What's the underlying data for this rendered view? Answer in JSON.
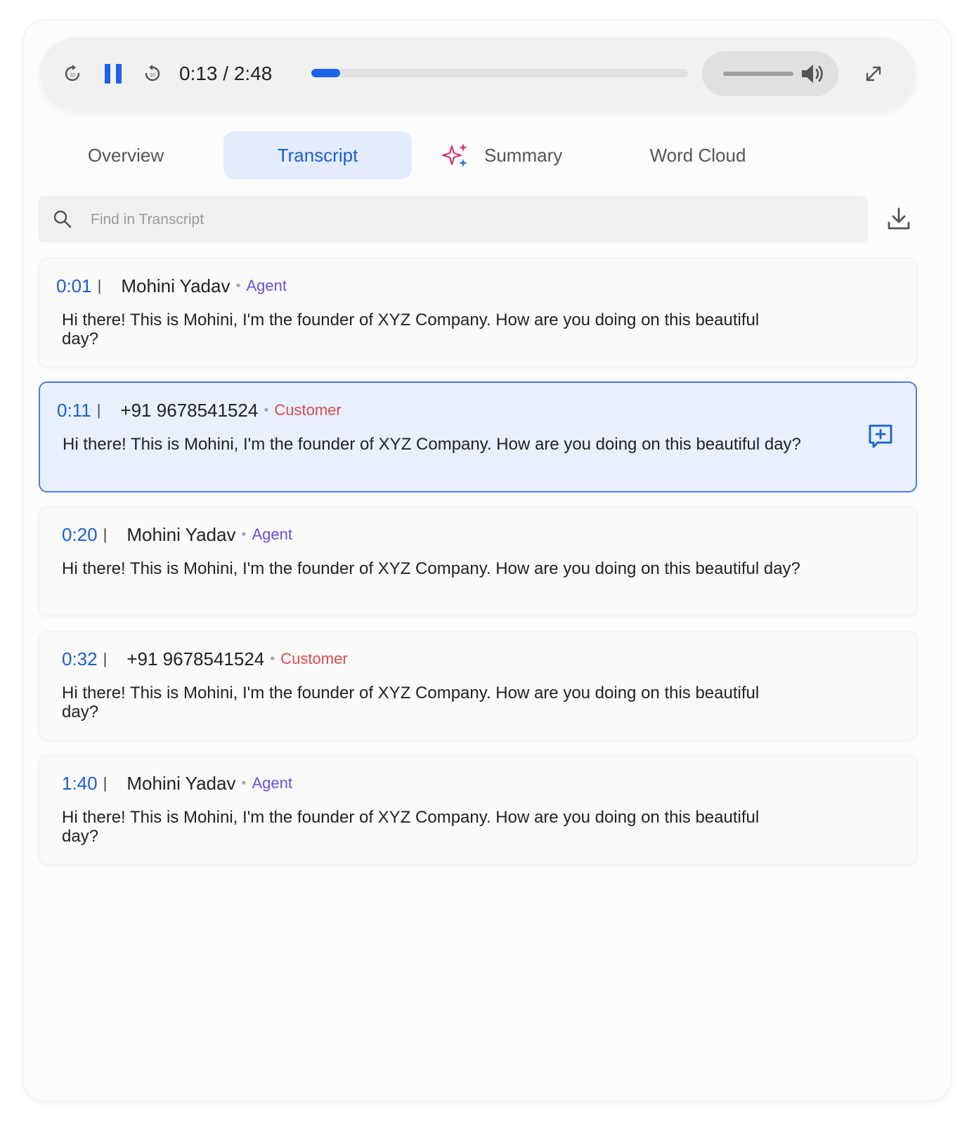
{
  "player": {
    "current_time": "0:13",
    "duration": "2:48",
    "time_label": "0:13 / 2:48",
    "progress_fraction": 0.077,
    "volume_fraction": 1.0,
    "icons": [
      "rewind-10-icon",
      "pause-icon",
      "forward-10-icon",
      "volume-icon",
      "expand-icon"
    ],
    "accent_color": "#1a63e8"
  },
  "tabs": [
    {
      "label": "Overview",
      "active": false
    },
    {
      "label": "Transcript",
      "active": true
    },
    {
      "label": "Summary",
      "active": false,
      "icon": "sparkle-icon"
    },
    {
      "label": "Word Cloud",
      "active": false
    }
  ],
  "search": {
    "placeholder": "Find in Transcript",
    "value": ""
  },
  "transcript": [
    {
      "time": "0:01",
      "speaker": "Mohini Yadav",
      "role": "Agent",
      "text": "Hi there! This is Mohini, I'm the founder of XYZ Company. How are you doing on this beautiful day?",
      "selected": false
    },
    {
      "time": "0:11",
      "speaker": "+91 9678541524",
      "role": "Customer",
      "text": "Hi there! This is Mohini, I'm the founder of XYZ Company. How are you doing on this beautiful day?",
      "selected": true
    },
    {
      "time": "0:20",
      "speaker": "Mohini Yadav",
      "role": "Agent",
      "text": "Hi there! This is Mohini, I'm the founder of XYZ Company. How are you doing on this beautiful day?",
      "selected": false
    },
    {
      "time": "0:32",
      "speaker": "+91 9678541524",
      "role": "Customer",
      "text": "Hi there! This is Mohini, I'm the founder of XYZ Company. How are you doing on this beautiful day?",
      "selected": false
    },
    {
      "time": "1:40",
      "speaker": "Mohini Yadav",
      "role": "Agent",
      "text": "Hi there! This is Mohini, I'm the founder of XYZ Company. How are you doing on this beautiful day?",
      "selected": false
    }
  ],
  "colors": {
    "agent": "#6a4fd8",
    "customer": "#d94b4b",
    "timestamp": "#1a5fd0",
    "selected_bg": "#e8effd"
  }
}
